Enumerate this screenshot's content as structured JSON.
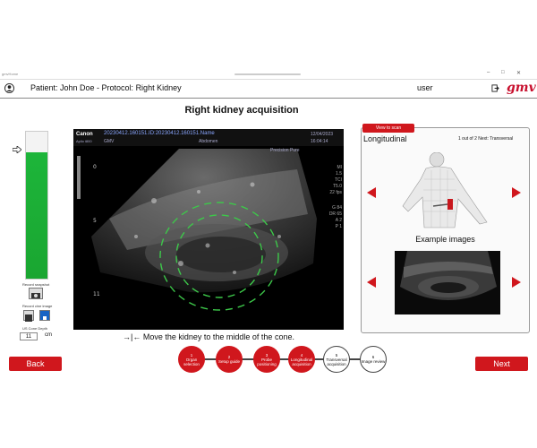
{
  "window": {
    "titlebar_text": "gmvHome"
  },
  "header": {
    "patient_text": "Patient: John Doe - Protocol: Right Kidney",
    "user": "user",
    "logo_text": "gmv"
  },
  "page": {
    "title": "Right kidney acquisition"
  },
  "left": {
    "gauge_level": 0.86,
    "record_snapshot_label": "Record snapshot",
    "record_cine_label": "Record cine image",
    "depth_label": "US Cone Depth",
    "depth_value": "11",
    "depth_unit": "cm"
  },
  "ultrasound": {
    "brand": "Canon",
    "model": "Aplio i800",
    "id_line": "20230412.160151.ID:20230412.160151.Name",
    "sub_left": "GMV",
    "preset": "Abdomen",
    "mode_line": "Precision  Pure",
    "date": "12/04/2023",
    "time": "16:04:14",
    "right_params": [
      "MI",
      "1.5",
      "TCI",
      "T5.0",
      "22 fps"
    ],
    "right_params2": [
      "G 84",
      "DR 65",
      "A 2",
      "P 1"
    ],
    "depth_marks": [
      "0",
      "5",
      "11"
    ]
  },
  "instruction": "→|← Move the kidney to the middle of the cone.",
  "right_panel": {
    "view_to_scan": "View to scan",
    "orientation": "Longitudinal",
    "progress": "1 out of 2 Next: Transversal",
    "examples_title": "Example images"
  },
  "footer": {
    "back": "Back",
    "next": "Next",
    "steps": [
      {
        "num": "1",
        "label": "Organ selection",
        "state": "done"
      },
      {
        "num": "2",
        "label": "Setup guide",
        "state": "done"
      },
      {
        "num": "3",
        "label": "Probe positioning",
        "state": "done"
      },
      {
        "num": "4",
        "label": "Longitudinal acquisition",
        "state": "done"
      },
      {
        "num": "5",
        "label": "Transversal acquisition",
        "state": "todo"
      },
      {
        "num": "6",
        "label": "Image review",
        "state": "todo"
      }
    ]
  },
  "colors": {
    "accent": "#d0171d",
    "gauge": "#1db53a"
  }
}
